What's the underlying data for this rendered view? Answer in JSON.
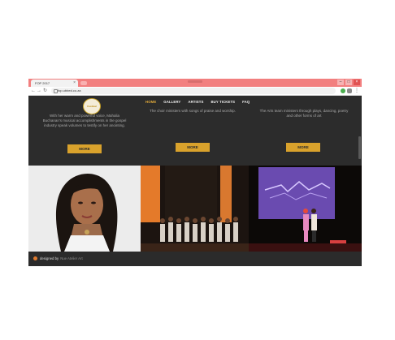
{
  "browser": {
    "tab_title": "FOP 2017",
    "url": "fop.ubbed.co.za",
    "window_buttons": [
      "–",
      "□",
      "×"
    ],
    "back_label": "←",
    "forward_label": "→",
    "reload_label": "↻",
    "menu_label": "⋮",
    "tab_close_label": "×"
  },
  "site": {
    "logo_text": "Festival",
    "nav": [
      "HOME",
      "GALLERY",
      "ARTISTS",
      "BUY TICKETS",
      "FAQ"
    ],
    "columns": [
      {
        "text": "With her warm and powerful voice, Mahalia Buchanan's musical accomplishments in the gospel industry speak volumes to testify on her anointing.",
        "button": "MORE"
      },
      {
        "text": "The choir ministers with songs of praise and worship.",
        "button": "MORE"
      },
      {
        "text": "The Arts team ministers through plays, dancing, poetry and other forms of art",
        "button": "MORE"
      }
    ],
    "footer": {
      "designed_by": "designed by",
      "brand": "Nue Atelier Art"
    }
  },
  "colors": {
    "accent": "#d9a22c",
    "chrome": "#f27f7f",
    "dark": "#2b2b2b"
  }
}
